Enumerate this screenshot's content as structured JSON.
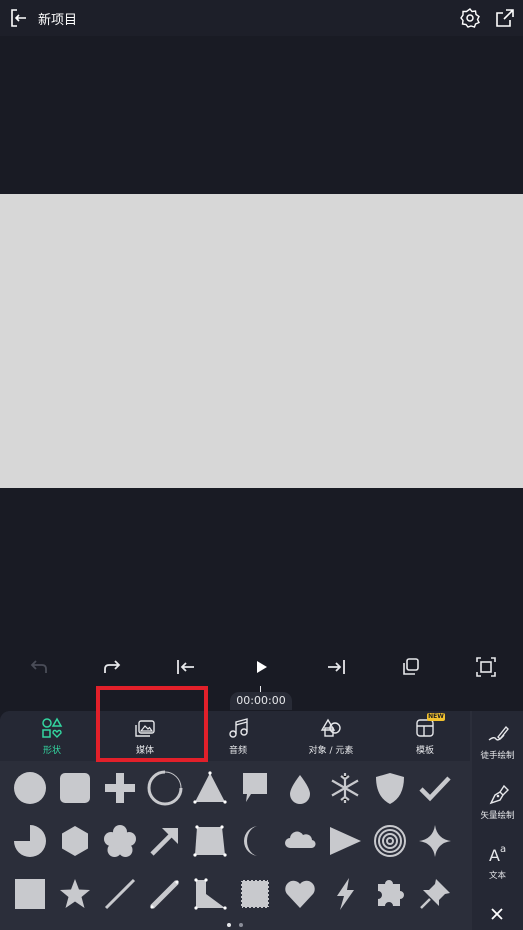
{
  "header": {
    "title": "新项目",
    "icons": [
      "exit-icon",
      "gear-icon",
      "share-icon"
    ]
  },
  "toolbar": {
    "buttons": [
      "undo",
      "redo",
      "jump-start",
      "play",
      "jump-end",
      "copy",
      "fit-screen"
    ]
  },
  "timeline": {
    "time": "00:00:00"
  },
  "tabs": [
    {
      "label": "形状",
      "active": true
    },
    {
      "label": "媒体",
      "active": false
    },
    {
      "label": "音频",
      "active": false
    },
    {
      "label": "对象 / 元素",
      "active": false
    },
    {
      "label": "模板",
      "active": false,
      "badge": "NEW"
    }
  ],
  "side_tools": [
    {
      "label": "徒手绘制"
    },
    {
      "label": "矢量绘制"
    },
    {
      "label": "文本"
    }
  ],
  "shapes": [
    "circle",
    "rounded-square",
    "plus",
    "ring-arc",
    "triangle",
    "speech-bubble",
    "drop",
    "snowflake",
    "shield",
    "check",
    "pie",
    "hexagon",
    "flower",
    "arrow",
    "quad",
    "crescent",
    "cloud",
    "play-triangle",
    "spiral",
    "sparkle",
    "square",
    "star",
    "line",
    "pencil-line",
    "bent-quad",
    "stamp",
    "heart",
    "lightning",
    "puzzle",
    "pushpin"
  ],
  "colors": {
    "accent": "#33d6a0",
    "shape": "#c8c9cd",
    "highlight": "#e2202a",
    "badge": "#f2c230"
  },
  "page_indicator": {
    "pages": 2,
    "current": 1
  }
}
